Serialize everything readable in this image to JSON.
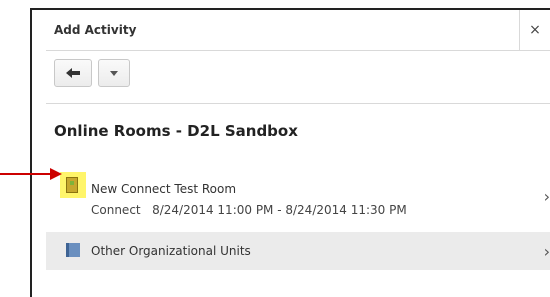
{
  "dialog": {
    "title": "Add Activity",
    "close_glyph": "×",
    "toolbar": {
      "back_icon": "arrow-left-icon",
      "menu_icon": "chevron-down-icon"
    },
    "org_unit_title": "Online Rooms - D2L Sandbox",
    "items": [
      {
        "name": "New Connect Test Room",
        "type": "Connect",
        "time": "8/24/2014 11:00 PM - 8/24/2014 11:30 PM",
        "icon": "connect-room-icon",
        "highlighted": true
      },
      {
        "name": "Other Organizational Units",
        "icon": "book-icon"
      }
    ],
    "chevron_glyph": "›"
  },
  "annotation": {
    "arrow_color": "#cc0000",
    "highlight_color": "#fff56a"
  }
}
